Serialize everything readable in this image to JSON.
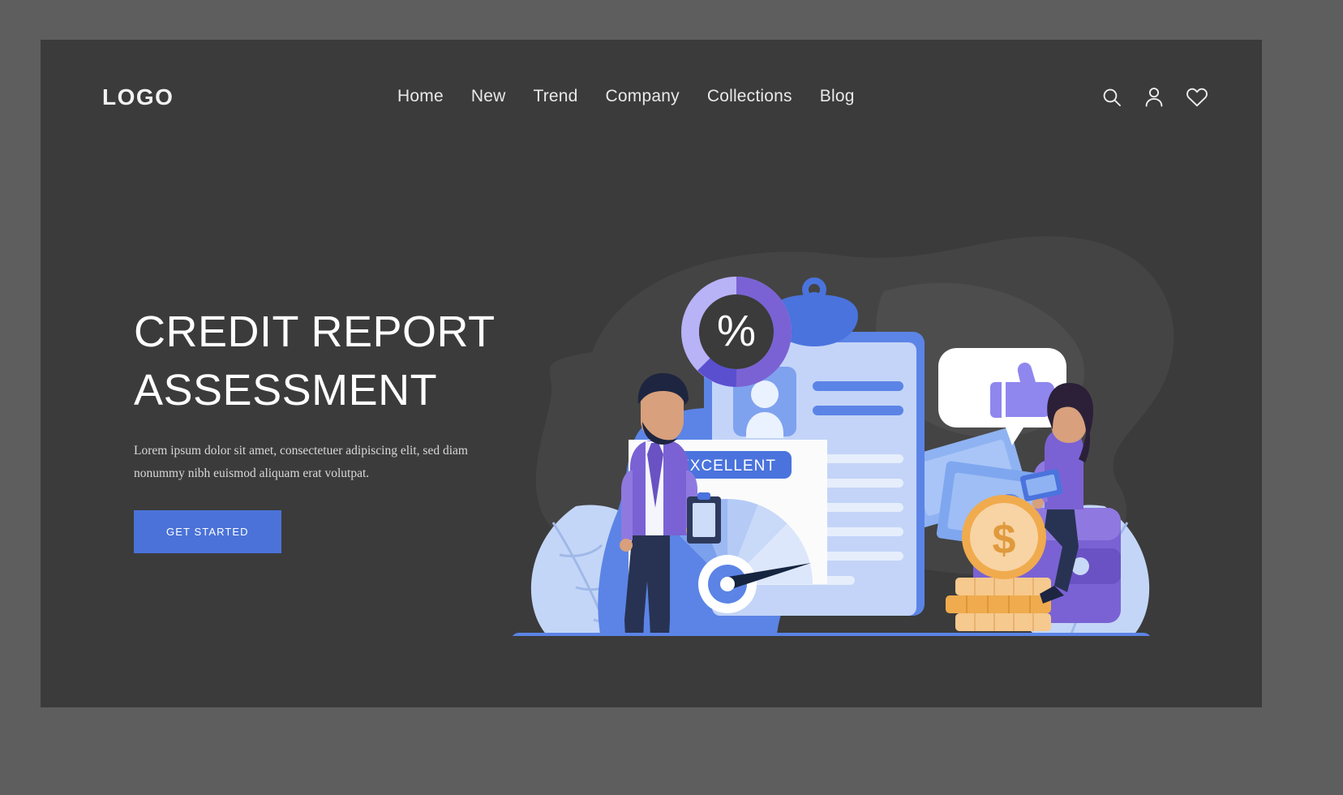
{
  "theme": {
    "outer_background": "#5e5e5e",
    "card_background": "#3b3b3b",
    "accent": "#4a72d8",
    "text_primary": "#ffffff",
    "text_secondary": "#d8d8d8",
    "illustration_blue": "#4f7ae0",
    "illustration_light_blue": "#bcd0f5",
    "illustration_purple": "#7a62d4",
    "illustration_gold": "#f0ab4e"
  },
  "header": {
    "logo": "LOGO",
    "nav": [
      {
        "label": "Home"
      },
      {
        "label": "New"
      },
      {
        "label": "Trend"
      },
      {
        "label": "Company"
      },
      {
        "label": "Collections"
      },
      {
        "label": "Blog"
      }
    ],
    "icons": [
      {
        "name": "search-icon",
        "label": "Search"
      },
      {
        "name": "user-icon",
        "label": "Account"
      },
      {
        "name": "heart-icon",
        "label": "Favorites"
      }
    ]
  },
  "hero": {
    "title_line1": "CREDIT REPORT",
    "title_line2": "ASSESSMENT",
    "paragraph": "Lorem ipsum dolor sit amet, consectetuer adipiscing elit, sed diam nonummy nibh euismod aliquam erat volutpat.",
    "cta_label": "GET STARTED"
  },
  "illustration": {
    "name": "credit-report-assessment-illustration",
    "percent_symbol": "%",
    "score_badge": "EXCELLENT",
    "coin_symbol": "$",
    "elements": [
      "percent-donut-chart",
      "clipboard-report",
      "id-avatar",
      "credit-score-gauge",
      "thumbs-up-bubble",
      "banknotes",
      "gold-coin",
      "coin-stack",
      "wallet",
      "man-with-clipboard",
      "woman-with-laptop",
      "leaf-plants"
    ]
  }
}
